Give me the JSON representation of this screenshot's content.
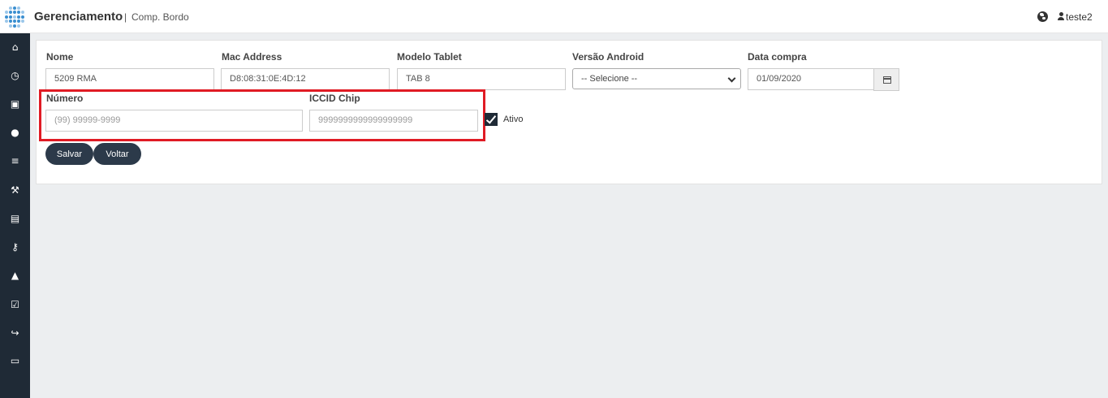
{
  "header": {
    "app_title": "Gerenciamento",
    "separator": "|",
    "subtitle": "Comp. Bordo",
    "user_name": "teste2"
  },
  "sidebar": {
    "items": [
      {
        "icon": "home-icon",
        "glyph": "⌂"
      },
      {
        "icon": "clock-icon",
        "glyph": "◷"
      },
      {
        "icon": "bus-icon",
        "glyph": "▣"
      },
      {
        "icon": "user-icon",
        "glyph": "●"
      },
      {
        "icon": "list-icon",
        "glyph": "≡"
      },
      {
        "icon": "wrench-icon",
        "glyph": "⚒"
      },
      {
        "icon": "archive-icon",
        "glyph": "▤"
      },
      {
        "icon": "key-icon",
        "glyph": "⚷"
      },
      {
        "icon": "lock-icon",
        "glyph": "▲"
      },
      {
        "icon": "check-square-icon",
        "glyph": "☑"
      },
      {
        "icon": "share-icon",
        "glyph": "↪"
      },
      {
        "icon": "money-icon",
        "glyph": "▭"
      }
    ]
  },
  "form": {
    "nome": {
      "label": "Nome",
      "value": "5209 RMA"
    },
    "mac": {
      "label": "Mac Address",
      "value": "D8:08:31:0E:4D:12"
    },
    "modelo": {
      "label": "Modelo Tablet",
      "value": "TAB 8"
    },
    "versao": {
      "label": "Versão Android",
      "value": "-- Selecione --"
    },
    "data_compra": {
      "label": "Data compra",
      "value": "01/09/2020"
    },
    "numero": {
      "label": "Número",
      "placeholder": "(99) 99999-9999"
    },
    "iccid": {
      "label": "ICCID Chip",
      "placeholder": "9999999999999999999"
    },
    "ativo": {
      "label": "Ativo",
      "checked": true
    }
  },
  "buttons": {
    "salvar": "Salvar",
    "voltar": "Voltar"
  },
  "colors": {
    "sidebar_bg": "#1f2a36",
    "button_bg": "#2c3a4a",
    "highlight": "#e01b24"
  }
}
